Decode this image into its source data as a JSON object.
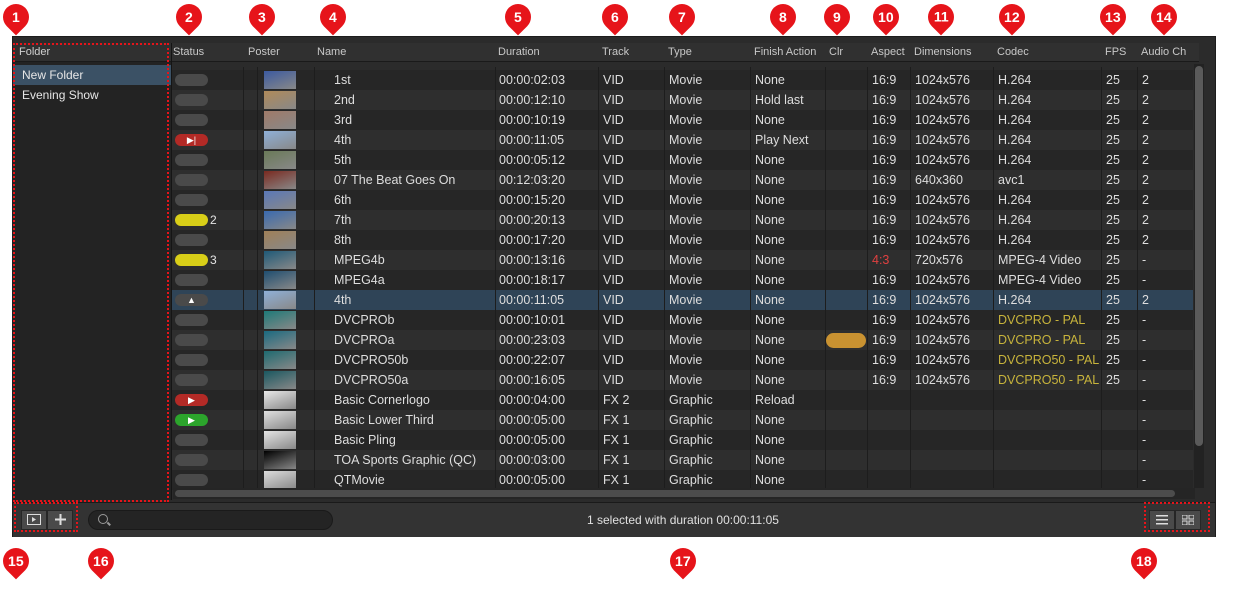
{
  "folders": {
    "header": "Folder",
    "items": [
      {
        "label": "New Folder",
        "selected": true
      },
      {
        "label": "Evening Show",
        "selected": false
      }
    ]
  },
  "columns": [
    "Status",
    "Poster",
    "Name",
    "Duration",
    "Track",
    "Type",
    "Finish Action",
    "Clr",
    "Aspect",
    "Dimensions",
    "Codec",
    "FPS",
    "Audio Ch"
  ],
  "rows": [
    {
      "status": "gray",
      "badge": "",
      "name": "1st",
      "duration": "00:00:02:03",
      "track": "VID",
      "type": "Movie",
      "finish": "None",
      "clr": "",
      "aspect": "16:9",
      "dims": "1024x576",
      "codec": "H.264",
      "fps": "25",
      "audio": "2",
      "thumb": "#3c5aa0"
    },
    {
      "status": "gray",
      "badge": "",
      "name": "2nd",
      "duration": "00:00:12:10",
      "track": "VID",
      "type": "Movie",
      "finish": "Hold last",
      "clr": "",
      "aspect": "16:9",
      "dims": "1024x576",
      "codec": "H.264",
      "fps": "25",
      "audio": "2",
      "thumb": "#b08a5a"
    },
    {
      "status": "gray",
      "badge": "",
      "name": "3rd",
      "duration": "00:00:10:19",
      "track": "VID",
      "type": "Movie",
      "finish": "None",
      "clr": "",
      "aspect": "16:9",
      "dims": "1024x576",
      "codec": "H.264",
      "fps": "25",
      "audio": "2",
      "thumb": "#a07a68"
    },
    {
      "status": "red-skip",
      "badge": "",
      "name": "4th",
      "duration": "00:00:11:05",
      "track": "VID",
      "type": "Movie",
      "finish": "Play Next",
      "clr": "",
      "aspect": "16:9",
      "dims": "1024x576",
      "codec": "H.264",
      "fps": "25",
      "audio": "2",
      "thumb": "#8fb0d8"
    },
    {
      "status": "gray",
      "badge": "",
      "name": "5th",
      "duration": "00:00:05:12",
      "track": "VID",
      "type": "Movie",
      "finish": "None",
      "clr": "",
      "aspect": "16:9",
      "dims": "1024x576",
      "codec": "H.264",
      "fps": "25",
      "audio": "2",
      "thumb": "#6a7a58"
    },
    {
      "status": "gray",
      "badge": "",
      "name": "07 The Beat Goes On",
      "duration": "00:12:03:20",
      "track": "VID",
      "type": "Movie",
      "finish": "None",
      "clr": "",
      "aspect": "16:9",
      "dims": "640x360",
      "codec": "avc1",
      "fps": "25",
      "audio": "2",
      "thumb": "#7a2a20"
    },
    {
      "status": "gray",
      "badge": "",
      "name": "6th",
      "duration": "00:00:15:20",
      "track": "VID",
      "type": "Movie",
      "finish": "None",
      "clr": "",
      "aspect": "16:9",
      "dims": "1024x576",
      "codec": "H.264",
      "fps": "25",
      "audio": "2",
      "thumb": "#5a78b8"
    },
    {
      "status": "yellow",
      "badge": "2",
      "name": "7th",
      "duration": "00:00:20:13",
      "track": "VID",
      "type": "Movie",
      "finish": "None",
      "clr": "",
      "aspect": "16:9",
      "dims": "1024x576",
      "codec": "H.264",
      "fps": "25",
      "audio": "2",
      "thumb": "#3a6ab0"
    },
    {
      "status": "gray",
      "badge": "",
      "name": "8th",
      "duration": "00:00:17:20",
      "track": "VID",
      "type": "Movie",
      "finish": "None",
      "clr": "",
      "aspect": "16:9",
      "dims": "1024x576",
      "codec": "H.264",
      "fps": "25",
      "audio": "2",
      "thumb": "#a08058"
    },
    {
      "status": "yellow",
      "badge": "3",
      "name": "MPEG4b",
      "duration": "00:00:13:16",
      "track": "VID",
      "type": "Movie",
      "finish": "None",
      "clr": "",
      "aspect": "4:3",
      "aspect_warn": true,
      "dims": "720x576",
      "codec": "MPEG-4 Video",
      "fps": "25",
      "audio": "-",
      "thumb": "#1f5a78"
    },
    {
      "status": "gray",
      "badge": "",
      "name": "MPEG4a",
      "duration": "00:00:18:17",
      "track": "VID",
      "type": "Movie",
      "finish": "None",
      "clr": "",
      "aspect": "16:9",
      "dims": "1024x576",
      "codec": "MPEG-4 Video",
      "fps": "25",
      "audio": "-",
      "thumb": "#1f4e70"
    },
    {
      "status": "gray-up",
      "badge": "",
      "name": "4th",
      "duration": "00:00:11:05",
      "track": "VID",
      "type": "Movie",
      "finish": "None",
      "clr": "",
      "aspect": "16:9",
      "dims": "1024x576",
      "codec": "H.264",
      "fps": "25",
      "audio": "2",
      "thumb": "#8fb0d8",
      "selected": true
    },
    {
      "status": "gray",
      "badge": "",
      "name": "DVCPROb",
      "duration": "00:00:10:01",
      "track": "VID",
      "type": "Movie",
      "finish": "None",
      "clr": "",
      "aspect": "16:9",
      "dims": "1024x576",
      "codec": "DVCPRO - PAL",
      "codec_warn": true,
      "fps": "25",
      "audio": "-",
      "thumb": "#1e7a78"
    },
    {
      "status": "gray",
      "badge": "",
      "name": "DVCPROa",
      "duration": "00:00:23:03",
      "track": "VID",
      "type": "Movie",
      "finish": "None",
      "clr": "orange",
      "aspect": "16:9",
      "dims": "1024x576",
      "codec": "DVCPRO - PAL",
      "codec_warn": true,
      "fps": "25",
      "audio": "-",
      "thumb": "#1a6a80"
    },
    {
      "status": "gray",
      "badge": "",
      "name": "DVCPRO50b",
      "duration": "00:00:22:07",
      "track": "VID",
      "type": "Movie",
      "finish": "None",
      "clr": "",
      "aspect": "16:9",
      "dims": "1024x576",
      "codec": "DVCPRO50 - PAL",
      "codec_warn": true,
      "fps": "25",
      "audio": "-",
      "thumb": "#1e6a70"
    },
    {
      "status": "gray",
      "badge": "",
      "name": "DVCPRO50a",
      "duration": "00:00:16:05",
      "track": "VID",
      "type": "Movie",
      "finish": "None",
      "clr": "",
      "aspect": "16:9",
      "dims": "1024x576",
      "codec": "DVCPRO50 - PAL",
      "codec_warn": true,
      "fps": "25",
      "audio": "-",
      "thumb": "#1a5860"
    },
    {
      "status": "red-play",
      "badge": "",
      "name": "Basic Cornerlogo",
      "duration": "00:00:04:00",
      "track": "FX 2",
      "type": "Graphic",
      "finish": "Reload",
      "clr": "",
      "aspect": "",
      "dims": "",
      "codec": "",
      "fps": "",
      "audio": "-",
      "thumb": "#e8e8e8"
    },
    {
      "status": "green-play",
      "badge": "",
      "name": "Basic Lower Third",
      "duration": "00:00:05:00",
      "track": "FX 1",
      "type": "Graphic",
      "finish": "None",
      "clr": "",
      "aspect": "",
      "dims": "",
      "codec": "",
      "fps": "",
      "audio": "-",
      "thumb": "#e0e0e0"
    },
    {
      "status": "gray",
      "badge": "",
      "name": "Basic Pling",
      "duration": "00:00:05:00",
      "track": "FX 1",
      "type": "Graphic",
      "finish": "None",
      "clr": "",
      "aspect": "",
      "dims": "",
      "codec": "",
      "fps": "",
      "audio": "-",
      "thumb": "#e4e4e4"
    },
    {
      "status": "gray",
      "badge": "",
      "name": "TOA Sports Graphic (QC)",
      "duration": "00:00:03:00",
      "track": "FX 1",
      "type": "Graphic",
      "finish": "None",
      "clr": "",
      "aspect": "",
      "dims": "",
      "codec": "",
      "fps": "",
      "audio": "-",
      "thumb": "#000000"
    },
    {
      "status": "gray",
      "badge": "",
      "name": "QTMovie",
      "duration": "00:00:05:00",
      "track": "FX 1",
      "type": "Graphic",
      "finish": "None",
      "clr": "",
      "aspect": "",
      "dims": "",
      "codec": "",
      "fps": "",
      "audio": "-",
      "thumb": "#dcdcdc"
    }
  ],
  "status_bar": {
    "text": "1 selected with duration 00:00:11:05"
  },
  "bottom_buttons": {
    "poster_icon": "poster-view-icon",
    "add_icon": "plus-icon",
    "search_icon": "search-icon",
    "list_icon": "list-view-icon",
    "grid_icon": "grid-view-icon"
  },
  "annotations": [
    "1",
    "2",
    "3",
    "4",
    "5",
    "6",
    "7",
    "8",
    "9",
    "10",
    "11",
    "12",
    "13",
    "14",
    "15",
    "16",
    "17",
    "18"
  ],
  "colors": {
    "annotation": "#e6141a",
    "selected_row": "#2f4457",
    "warn_codec": "#c8b43c",
    "warn_aspect": "#e04040"
  }
}
